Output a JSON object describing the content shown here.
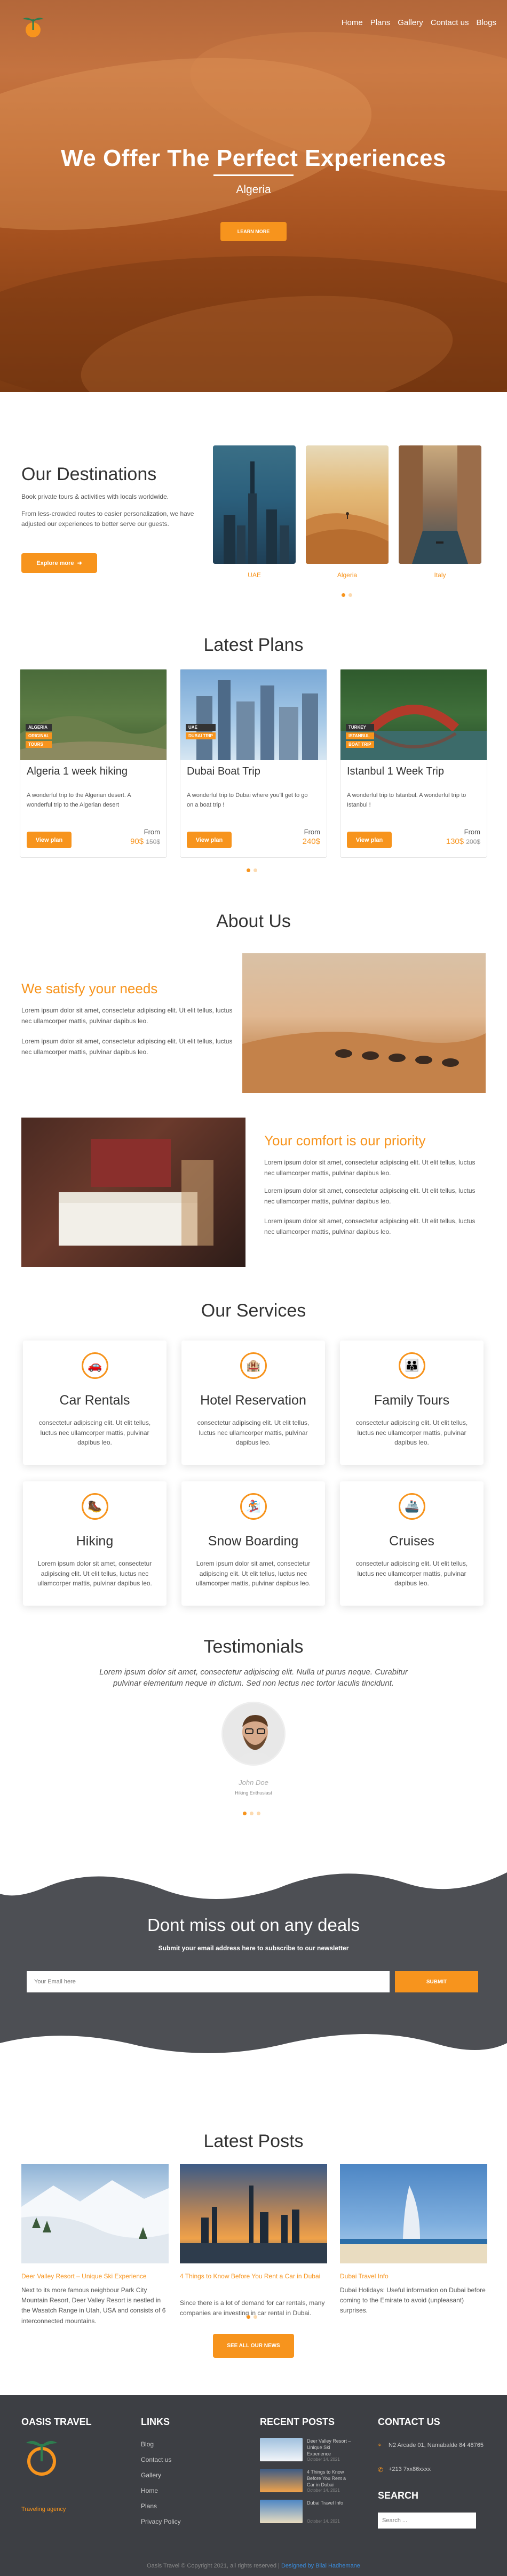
{
  "nav": {
    "items": [
      "Home",
      "Plans",
      "Gallery",
      "Contact us",
      "Blogs"
    ]
  },
  "hero": {
    "title": "We Offer The Perfect Experiences",
    "subtitle": "Algeria",
    "button": "LEARN MORE"
  },
  "destinations": {
    "title": "Our Destinations",
    "p1": "Book private tours & activities with locals worldwide.",
    "p2": "From less-crowded routes to easier personalization, we have adjusted our experiences to better serve our guests.",
    "button": "Explore more",
    "cards": [
      "UAE",
      "Algeria",
      "Italy"
    ]
  },
  "plans": {
    "title": "Latest Plans",
    "items": [
      {
        "tags": [
          "ALGERIA",
          "ORIGINAL",
          "TOURS"
        ],
        "title": "Algeria 1 week hiking",
        "desc": "A wonderful trip to the Algerian desert. A wonderful trip to the Algerian desert",
        "button": "View plan",
        "from": "From",
        "price": "90$",
        "old": "150$"
      },
      {
        "tags": [
          "UAE",
          "DUBAI TRIP"
        ],
        "title": "Dubai Boat Trip",
        "desc": "A wonderful trip to Dubai where you'll get to go on a boat trip !",
        "button": "View plan",
        "from": "From",
        "price": "240$",
        "old": ""
      },
      {
        "tags": [
          "TURKEY",
          "ISTANBUL",
          "BOAT TRIP"
        ],
        "title": "Istanbul 1 Week Trip",
        "desc": "A wonderful trip to Istanbul. A wonderful trip to Istanbul !",
        "button": "View plan",
        "from": "From",
        "price": "130$",
        "old": "200$"
      }
    ]
  },
  "about": {
    "title": "About Us",
    "h1": "We satisfy your needs",
    "p1a": "Lorem ipsum dolor sit amet, consectetur adipiscing elit. Ut elit tellus, luctus nec ullamcorper mattis, pulvinar dapibus leo.",
    "p1b": "Lorem ipsum dolor sit amet, consectetur adipiscing elit. Ut elit tellus, luctus nec ullamcorper mattis, pulvinar dapibus leo.",
    "h2": "Your comfort is our priority",
    "p2a": "Lorem ipsum dolor sit amet, consectetur adipiscing elit. Ut elit tellus, luctus nec ullamcorper mattis, pulvinar dapibus leo.",
    "p2b": "Lorem ipsum dolor sit amet, consectetur adipiscing elit. Ut elit tellus, luctus nec ullamcorper mattis, pulvinar dapibus leo.",
    "p2c": "Lorem ipsum dolor sit amet, consectetur adipiscing elit. Ut elit tellus, luctus nec ullamcorper mattis, pulvinar dapibus leo."
  },
  "services": {
    "title": "Our Services",
    "items": [
      {
        "icon": "car-icon",
        "title": "Car Rentals",
        "desc": "consectetur adipiscing elit. Ut elit tellus, luctus nec ullamcorper mattis, pulvinar dapibus leo."
      },
      {
        "icon": "hotel-icon",
        "title": "Hotel Reservation",
        "desc": "consectetur adipiscing elit. Ut elit tellus, luctus nec ullamcorper mattis, pulvinar dapibus leo."
      },
      {
        "icon": "family-icon",
        "title": "Family Tours",
        "desc": "consectetur adipiscing elit. Ut elit tellus, luctus nec ullamcorper mattis, pulvinar dapibus leo."
      },
      {
        "icon": "hiking-icon",
        "title": "Hiking",
        "desc": "Lorem ipsum dolor sit amet, consectetur adipiscing elit. Ut elit tellus, luctus nec ullamcorper mattis, pulvinar dapibus leo."
      },
      {
        "icon": "snowboarding-icon",
        "title": "Snow Boarding",
        "desc": "Lorem ipsum dolor sit amet, consectetur adipiscing elit. Ut elit tellus, luctus nec ullamcorper mattis, pulvinar dapibus leo."
      },
      {
        "icon": "ship-icon",
        "title": "Cruises",
        "desc": "consectetur adipiscing elit. Ut elit tellus, luctus nec ullamcorper mattis, pulvinar dapibus leo."
      }
    ]
  },
  "testimonials": {
    "title": "Testimonials",
    "quote": "Lorem ipsum dolor sit amet, consectetur adipiscing elit. Nulla ut purus neque. Curabitur pulvinar elementum neque in dictum. Sed non lectus nec tortor iaculis tincidunt.",
    "name": "John Doe",
    "role": "Hiking Enthusiast"
  },
  "newsletter": {
    "title": "Dont miss out on any deals",
    "subtitle": "Submit your email address here to subscribe to our newsletter",
    "placeholder": "Your Email here",
    "button": "SUBMIT"
  },
  "posts": {
    "title": "Latest Posts",
    "items": [
      {
        "title": "Deer Valley Resort – Unique Ski Experience",
        "desc": "Next to its more famous neighbour Park City Mountain Resort, Deer Valley Resort is nestled in the Wasatch Range in Utah, USA and consists of 6 interconnected mountains."
      },
      {
        "title": "4 Things to Know Before You Rent a Car in Dubai",
        "desc": "Since there is a lot of demand for car rentals, many companies are investing in car rental in Dubai."
      },
      {
        "title": "Dubai Travel Info",
        "desc": "Dubai Holidays: Useful information on Dubai before coming to the Emirate to avoid (unpleasant) surprises."
      }
    ],
    "button": "SEE ALL OUR NEWS"
  },
  "footer": {
    "brand": "OASIS TRAVEL",
    "agency": "Traveling agency",
    "links_title": "LINKS",
    "links": [
      "Blog",
      "Contact us",
      "Gallery",
      "Home",
      "Plans",
      "Privacy Policy"
    ],
    "recent_title": "RECENT POSTS",
    "recent": [
      {
        "title": "Deer Valley Resort – Unique Ski Experience",
        "date": "October 14, 2021"
      },
      {
        "title": "4 Things to Know Before You Rent a Car in Dubai",
        "date": "October 14, 2021"
      },
      {
        "title": "Dubai Travel Info",
        "date": "October 14, 2021"
      }
    ],
    "contact_title": "CONTACT US",
    "address": "N2 Arcade 01, Namabalde 84 48765",
    "phone": "+213 7xx86xxxx",
    "search_title": "SEARCH",
    "search_placeholder": "Search ...",
    "copyright": "Oasis Travel © Copyright 2021, all rights reserved | ",
    "designer": "Designed by Bilal Hadhemane"
  },
  "colors": {
    "accent": "#f7941d",
    "dark": "#4d4f54",
    "footer": "#3d3f44"
  }
}
